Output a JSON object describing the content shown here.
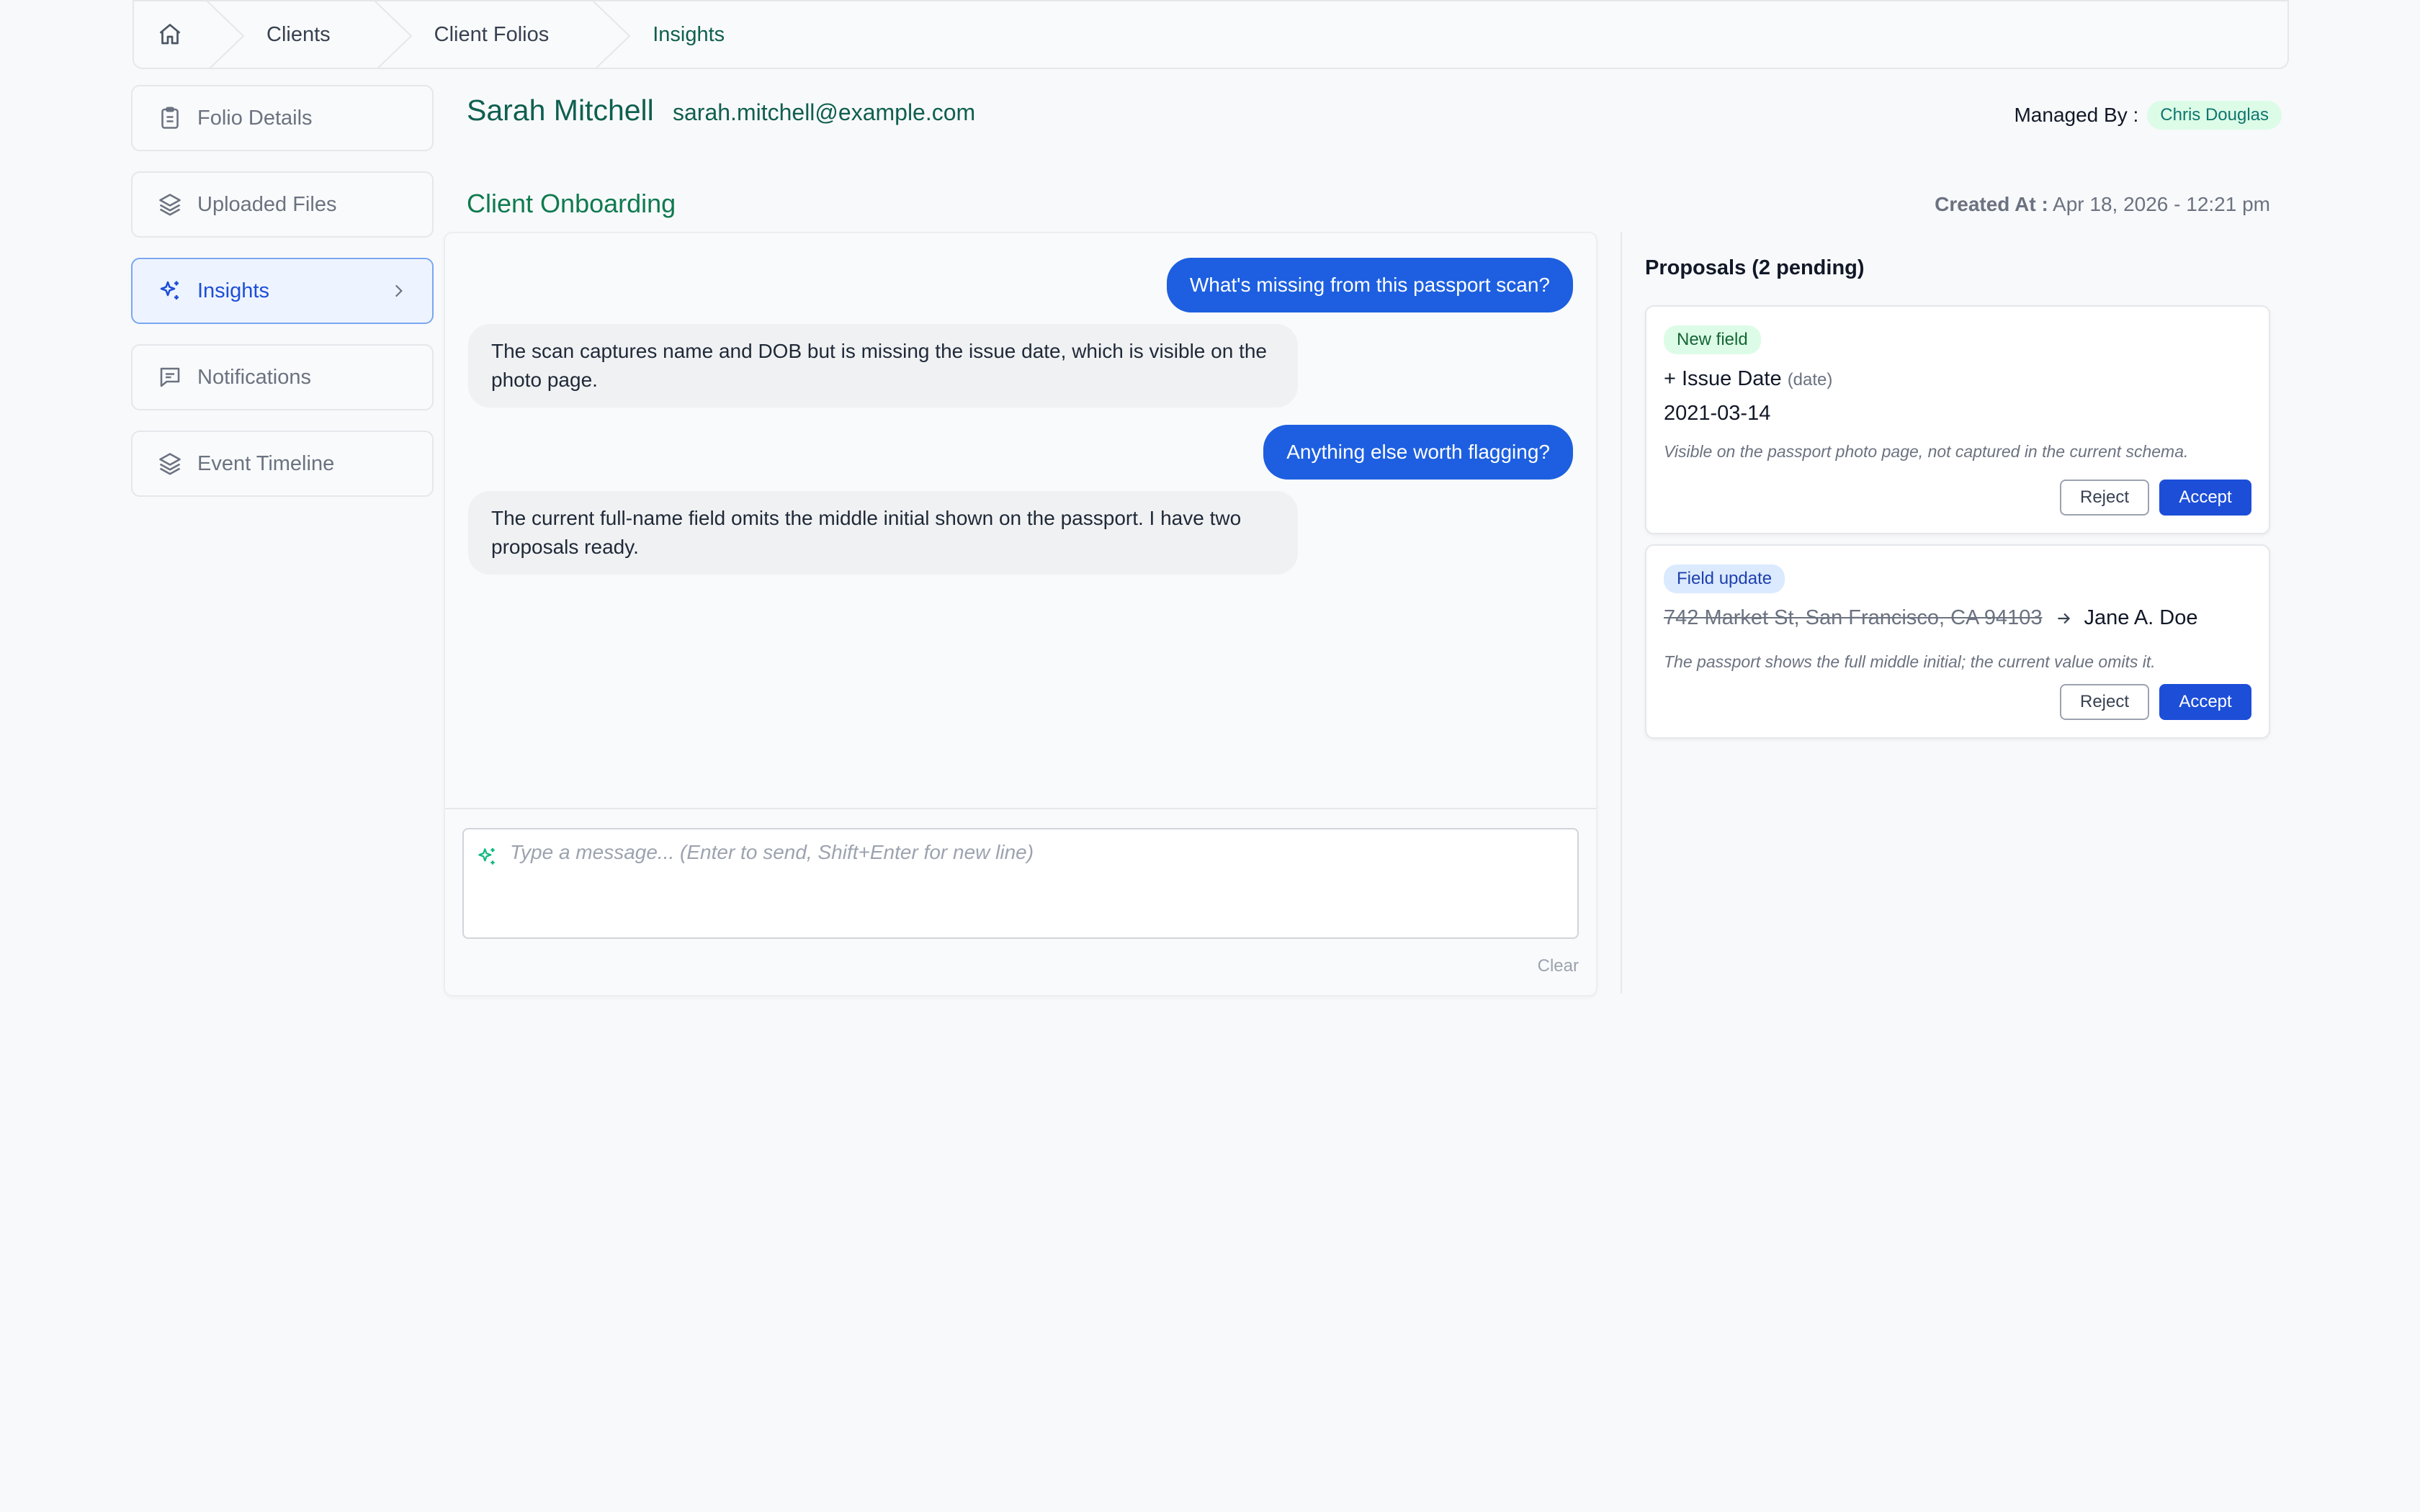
{
  "breadcrumb": {
    "items": [
      "Clients",
      "Client Folios",
      "Insights"
    ]
  },
  "sidebar": {
    "items": [
      {
        "label": "Folio Details",
        "icon": "clipboard-icon"
      },
      {
        "label": "Uploaded Files",
        "icon": "layers-icon"
      },
      {
        "label": "Insights",
        "icon": "sparkles-icon",
        "active": true
      },
      {
        "label": "Notifications",
        "icon": "message-square-icon"
      },
      {
        "label": "Event Timeline",
        "icon": "layers-icon"
      }
    ]
  },
  "header": {
    "client_name": "Sarah Mitchell",
    "client_email": "sarah.mitchell@example.com",
    "managed_by_label": "Managed By :",
    "managed_by": "Chris Douglas",
    "section_title": "Client Onboarding",
    "created_at_label": "Created At :",
    "created_at": "Apr 18, 2026 - 12:21 pm"
  },
  "chat": {
    "messages": [
      {
        "role": "user",
        "text": "What's missing from this passport scan?"
      },
      {
        "role": "assistant",
        "text": "The scan captures name and DOB but is missing the issue date, which is visible on the photo page."
      },
      {
        "role": "user",
        "text": "Anything else worth flagging?"
      },
      {
        "role": "assistant",
        "text": "The current full-name field omits the middle initial shown on the passport. I have two proposals ready."
      }
    ],
    "input_placeholder": "Type a message... (Enter to send, Shift+Enter for new line)",
    "input_value": "",
    "clear_label": "Clear"
  },
  "proposals": {
    "title": "Proposals (2 pending)",
    "items": [
      {
        "tag": "New field",
        "field_prefix": "+ Issue Date",
        "field_type": "(date)",
        "value": "2021-03-14",
        "note": "Visible on the passport photo page, not captured in the current schema.",
        "reject_label": "Reject",
        "accept_label": "Accept"
      },
      {
        "tag": "Field update",
        "old_value": "742 Market St, San Francisco, CA 94103",
        "new_value": "Jane A. Doe",
        "note": "The passport shows the full middle initial; the current value omits it.",
        "reject_label": "Reject",
        "accept_label": "Accept"
      }
    ]
  },
  "colors": {
    "brand_green": "#0f5f4f",
    "accent_blue": "#1d4ed8",
    "user_bubble": "#1d5fe0",
    "bot_bubble": "#f0f1f3",
    "page_bg": "#f8f9fb"
  }
}
